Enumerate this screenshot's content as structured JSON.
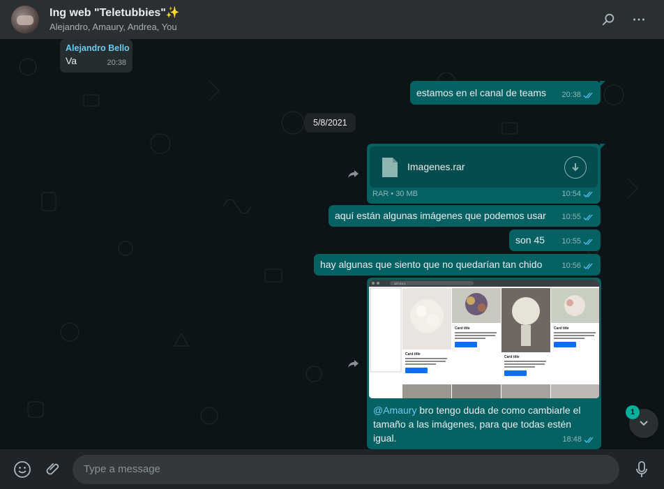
{
  "header": {
    "title": "Ing web \"Teletubbies\"✨",
    "participants": "Alejandro, Amaury, Andrea, You"
  },
  "messages": {
    "m1": {
      "sender": "Alejandro Bello",
      "text": "Va",
      "time": "20:38"
    },
    "m2": {
      "text": "estamos en el canal de teams",
      "time": "20:38"
    },
    "date_divider": "5/8/2021",
    "m3": {
      "file_name": "Imagenes.rar",
      "file_meta": "RAR • 30 MB",
      "time": "10:54"
    },
    "m4": {
      "text": "aquí están algunas imágenes que podemos usar",
      "time": "10:55"
    },
    "m5": {
      "text": "son 45",
      "time": "10:55"
    },
    "m6": {
      "text": "hay algunas que siento que no quedarían tan chido",
      "time": "10:56"
    },
    "m7": {
      "mention": "@Amaury",
      "text": " bro tengo duda de como cambiarle el tamaño a las imágenes, para que todas estén igual.",
      "time": "18:48",
      "preview": {
        "url": "127.0.0.1",
        "card_title": "Card title",
        "card_text": "Some quick example text to build on the card title and make up the bulk of the card's content.",
        "card_button": "Go somewhere"
      }
    }
  },
  "scroll": {
    "unread_count": "1"
  },
  "composer": {
    "placeholder": "Type a message"
  },
  "colors": {
    "outgoing": "#056162",
    "incoming": "#262d31",
    "accent": "#00af9c",
    "ticks": "#4fc3f7"
  }
}
